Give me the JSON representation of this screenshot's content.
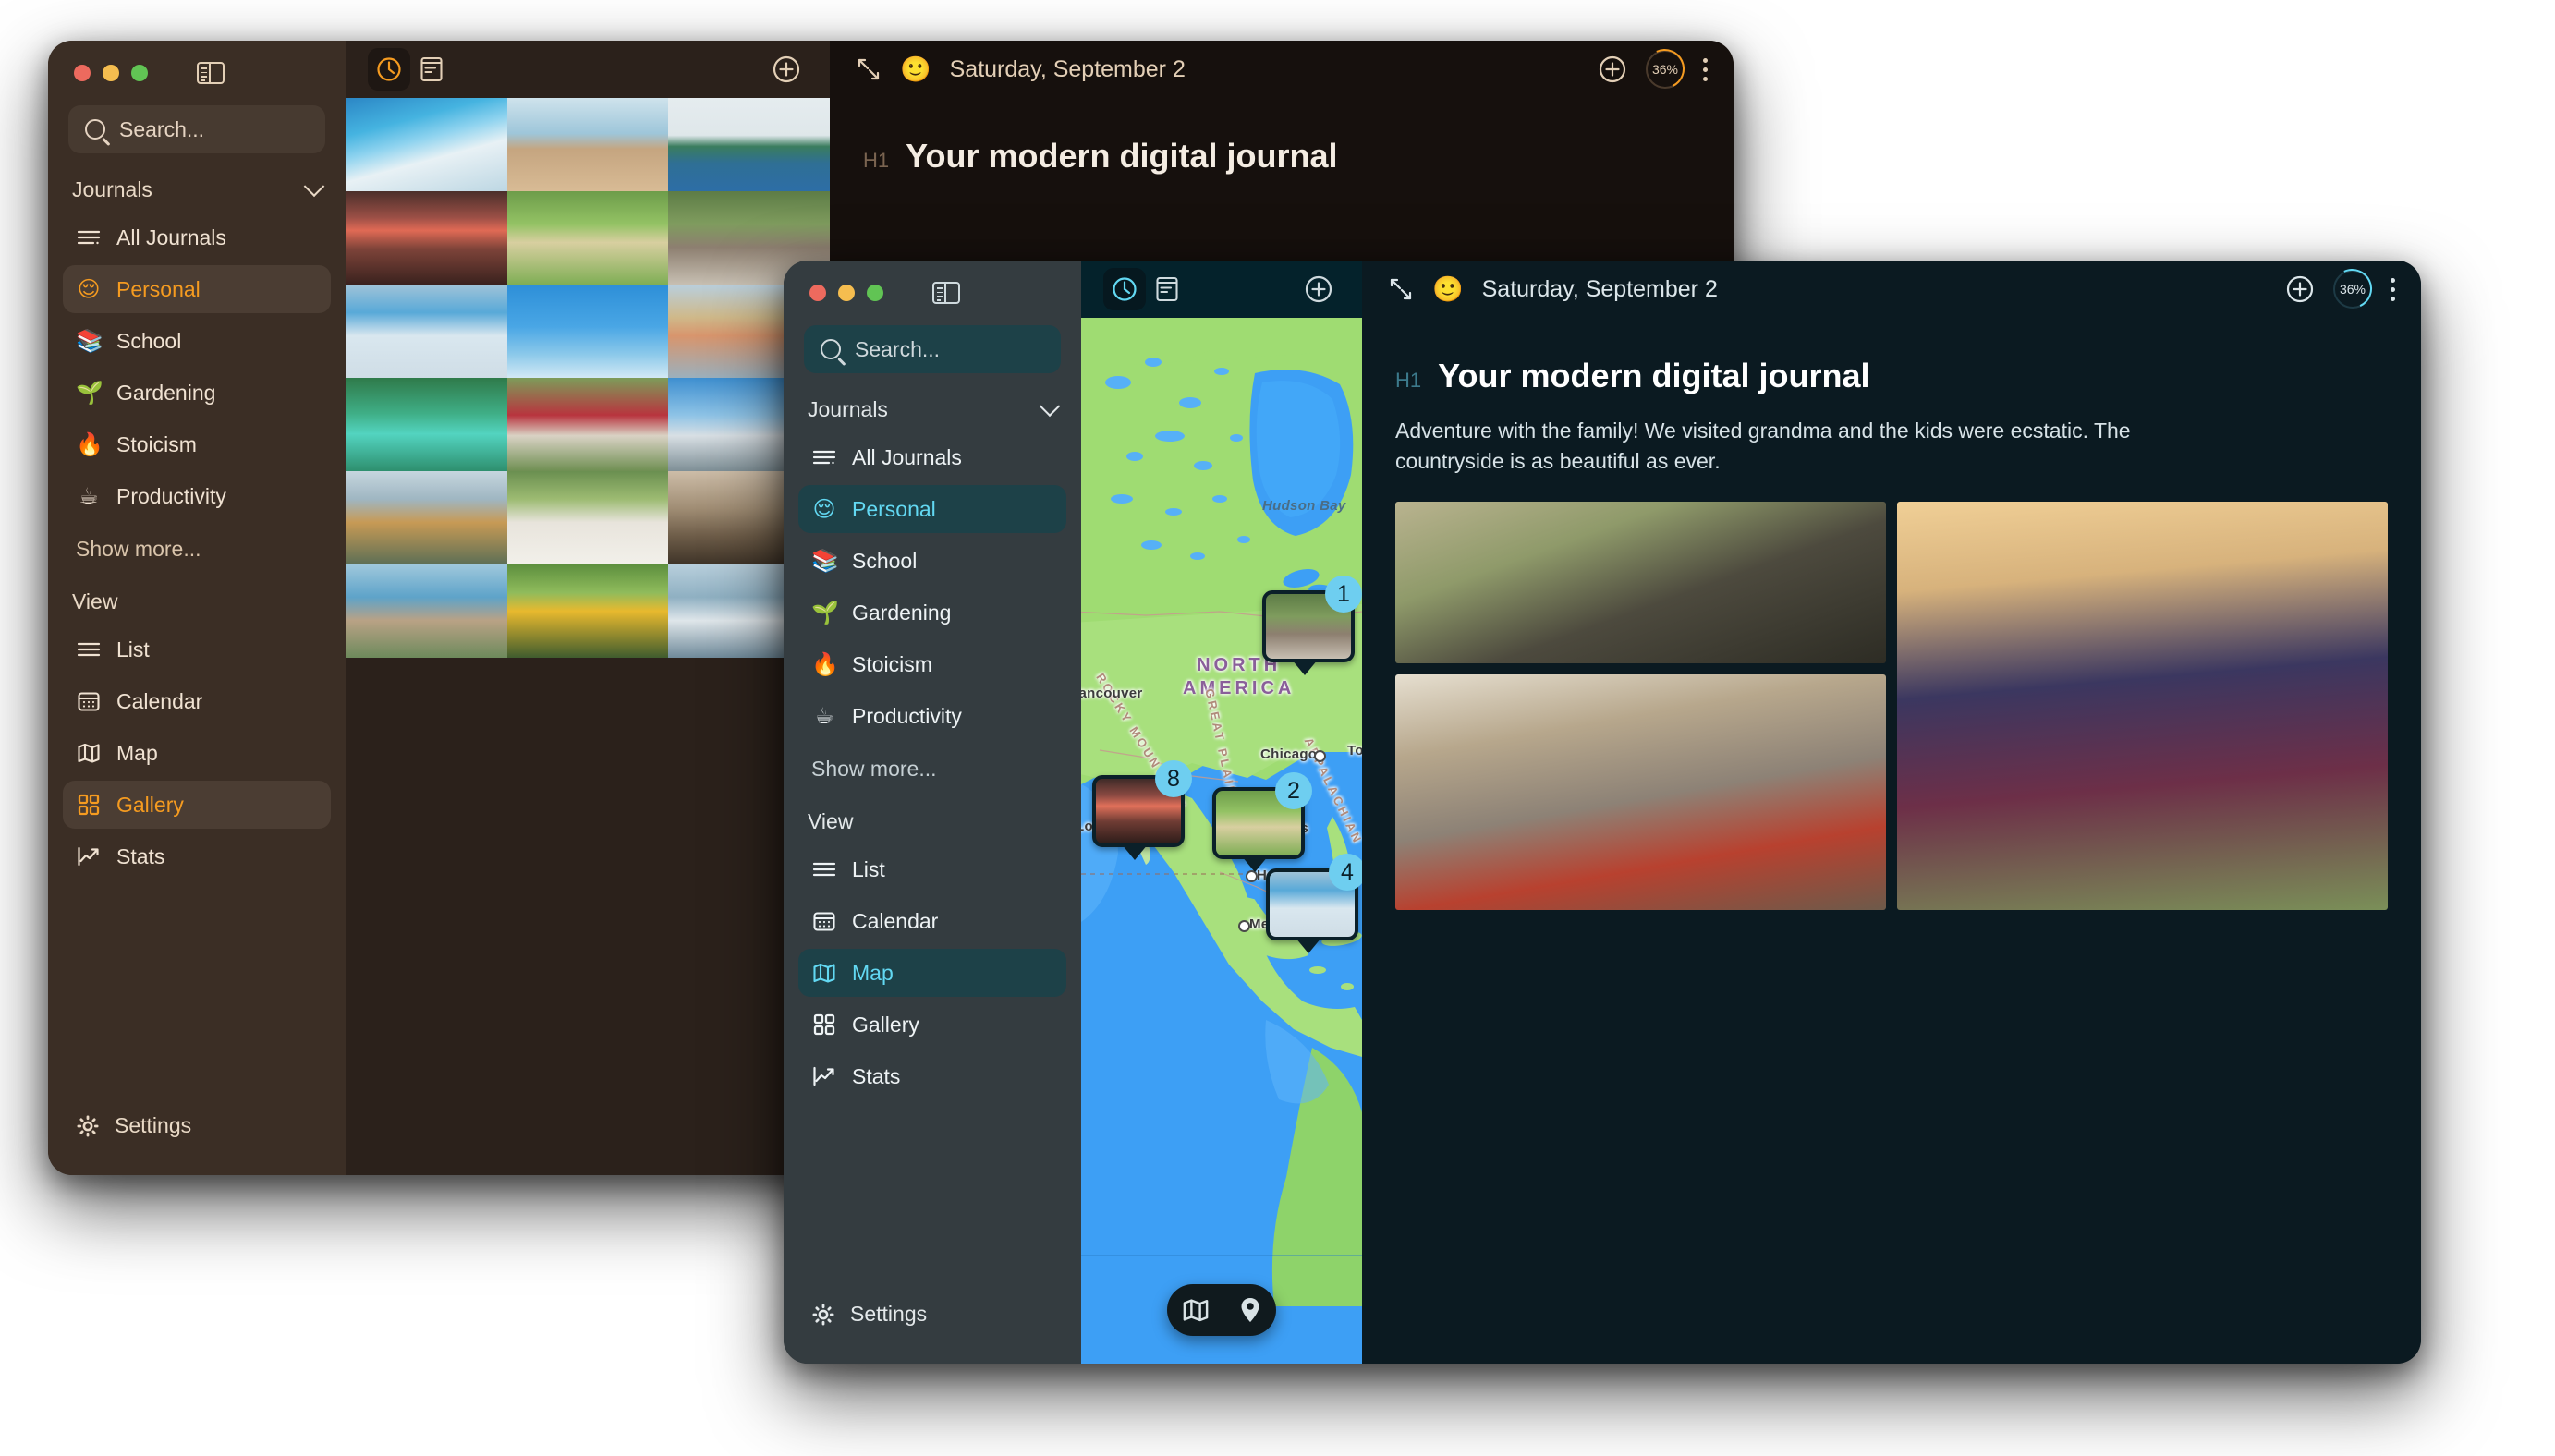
{
  "app": {
    "accent_back": "#f59b20",
    "accent_front": "#62d8f2",
    "search_placeholder": "Search...",
    "journals_heading": "Journals",
    "view_heading": "View",
    "show_more": "Show more...",
    "settings_label": "Settings"
  },
  "journals": [
    {
      "label": "All Journals",
      "icon": "list-lines-icon",
      "emoji": ""
    },
    {
      "label": "Personal",
      "icon": "emoji",
      "emoji": "😌"
    },
    {
      "label": "School",
      "icon": "emoji",
      "emoji": "📚"
    },
    {
      "label": "Gardening",
      "icon": "emoji",
      "emoji": "🌱"
    },
    {
      "label": "Stoicism",
      "icon": "emoji",
      "emoji": "🔥"
    },
    {
      "label": "Productivity",
      "icon": "emoji",
      "emoji": "☕"
    }
  ],
  "views": [
    {
      "label": "List",
      "icon": "list-icon"
    },
    {
      "label": "Calendar",
      "icon": "calendar-icon"
    },
    {
      "label": "Map",
      "icon": "map-icon"
    },
    {
      "label": "Gallery",
      "icon": "gallery-grid-icon"
    },
    {
      "label": "Stats",
      "icon": "stats-chart-icon"
    }
  ],
  "back_window": {
    "selected_journal": "Personal",
    "selected_view": "Gallery",
    "toolbar": {
      "timeline_icon": "clock-icon",
      "entries_icon": "document-icon",
      "add_icon": "plus-circle-icon"
    },
    "detail": {
      "expand_icon": "collapse-arrows-icon",
      "mood_emoji": "🙂",
      "date": "Saturday, September 2",
      "add_icon": "plus-circle-icon",
      "progress": "36%",
      "menu_icon": "kebab-menu-icon",
      "h1_tag": "H1",
      "h1_text": "Your modern digital journal"
    }
  },
  "front_window": {
    "selected_journal": "Personal",
    "selected_view": "Map",
    "toolbar": {
      "timeline_icon": "clock-icon",
      "entries_icon": "document-icon",
      "add_icon": "plus-circle-icon"
    },
    "detail": {
      "expand_icon": "collapse-arrows-icon",
      "mood_emoji": "🙂",
      "date": "Saturday, September 2",
      "add_icon": "plus-circle-icon",
      "progress": "36%",
      "menu_icon": "kebab-menu-icon",
      "h1_tag": "H1",
      "h1_text": "Your modern digital journal",
      "body_text": "Adventure with the family! We visited grandma and the kids were ecstatic. The countryside is as beautiful as ever."
    },
    "map": {
      "continent_label": "NORTH\nAMERICA",
      "sea_labels": [
        "Hudson Bay"
      ],
      "range_labels": [
        "ROCKY MOUNTAINS",
        "GREAT PLAINS",
        "APPALACHIAN"
      ],
      "cities": [
        "Vancouver",
        "Los Angeles",
        "Chicago",
        "Dallas",
        "Houston",
        "Mexico City",
        "Toronto"
      ],
      "pins": [
        {
          "count": "1",
          "photo": "woman-in-hat"
        },
        {
          "count": "8",
          "photo": "palm-street-sunset"
        },
        {
          "count": "2",
          "photo": "golden-retriever"
        },
        {
          "count": "4",
          "photo": "surfers-beach"
        }
      ],
      "controls": [
        {
          "icon": "map-icon",
          "name": "map-style-button"
        },
        {
          "icon": "pin-icon",
          "name": "map-pins-button"
        }
      ]
    }
  },
  "gallery_photos": [
    "blue-beach-house",
    "two-children-hugging",
    "sea-rock-island",
    "palm-street-sunset",
    "golden-retriever",
    "woman-in-hat",
    "surfers-beach",
    "skier-jump",
    "colorful-town-square",
    "turquoise-lagoon",
    "flower-road",
    "mountain-summit",
    "woman-reading-mountain",
    "white-samoyed-dog",
    "narrow-alley",
    "coastal-village",
    "toucan-bird",
    "snowy-peaks"
  ],
  "detail_photos": [
    "father-daughter-field",
    "two-girls-reading-book",
    "grandma-baking-with-child"
  ]
}
